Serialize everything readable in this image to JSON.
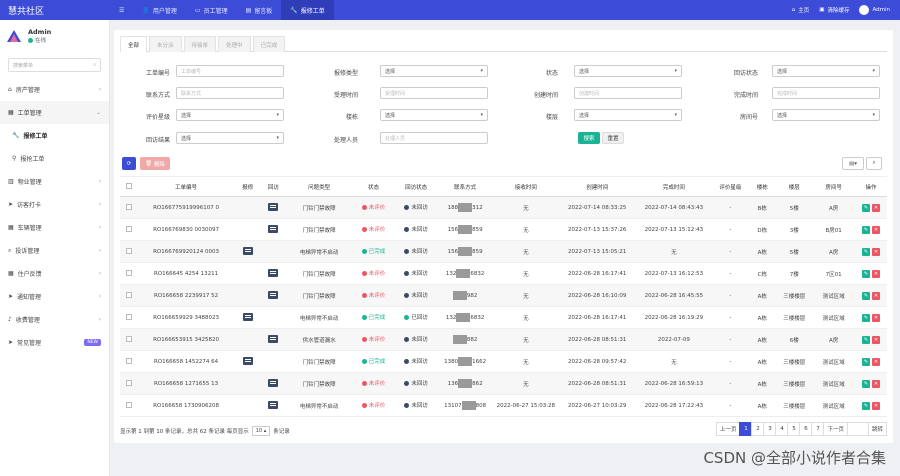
{
  "brand": "慧共社区",
  "topnav": [
    {
      "label": "用户管理",
      "icon": "user-icon"
    },
    {
      "label": "员工管理",
      "icon": "card-icon"
    },
    {
      "label": "留言板",
      "icon": "doc-icon"
    },
    {
      "label": "报修工单",
      "icon": "wrench-icon",
      "active": true
    }
  ],
  "topright": {
    "home": "主页",
    "clear": "清除缓存",
    "user": "Admin"
  },
  "sidebar": {
    "username": "Admin",
    "status": "在线",
    "search_placeholder": "搜索菜单",
    "items": [
      {
        "label": "房产管理",
        "icon": "home-icon"
      },
      {
        "label": "工单管理",
        "icon": "ticket-icon",
        "open": true
      },
      {
        "label": "报修工单",
        "icon": "wrench-icon",
        "sub": true,
        "active": true
      },
      {
        "label": "报抢工单",
        "icon": "pin-icon",
        "sub": true
      },
      {
        "label": "物业管理",
        "icon": "building-icon"
      },
      {
        "label": "访客打卡",
        "icon": "send-icon"
      },
      {
        "label": "车辆管理",
        "icon": "table-icon"
      },
      {
        "label": "投诉管理",
        "icon": "search-icon"
      },
      {
        "label": "住户反馈",
        "icon": "table-icon"
      },
      {
        "label": "通知管理",
        "icon": "send-icon"
      },
      {
        "label": "收费管理",
        "icon": "bell-icon"
      },
      {
        "label": "常见管理",
        "icon": "send-icon",
        "badge": "NEW"
      }
    ]
  },
  "tabs": [
    "全部",
    "未分派",
    "待接单",
    "处理中",
    "已完成"
  ],
  "filters": {
    "labels": [
      "工单编号",
      "报修类型",
      "状态",
      "回访状态",
      "联系方式",
      "受理时间",
      "创建时间",
      "完成时间",
      "评价星级",
      "楼栋",
      "楼层",
      "房间号",
      "回访结果",
      "处理人员"
    ],
    "order_no_placeholder": "工单编号",
    "contact_placeholder": "联系方式",
    "accept_time_placeholder": "受理时间",
    "create_time_placeholder": "创建时间",
    "finish_time_placeholder": "完成时间",
    "handler_placeholder": "处理人员",
    "select_label": "选择",
    "search_btn": "搜索",
    "reset_btn": "重置"
  },
  "toolbar": {
    "delete": "删除"
  },
  "table": {
    "headers": [
      "工单编号",
      "报修",
      "回访",
      "问题类型",
      "状态",
      "回访状态",
      "联系方式",
      "接收时间",
      "创建时间",
      "完成时间",
      "评价星级",
      "楼栋",
      "楼层",
      "房间号",
      "操作"
    ],
    "rows": [
      {
        "no": "RO166775919996107 0",
        "report": false,
        "visit": true,
        "type": "门铃门禁故障",
        "status": "未评价",
        "status_color": "#ed5565",
        "visit_status": "未回访",
        "visit_color": "#3b4a66",
        "phone_a": "188",
        "phone_b": "312",
        "accept": "无",
        "create": "2022-07-14 08:33:25",
        "finish": "2022-07-14 08:43:43",
        "star": "-",
        "bldg": "B栋",
        "floor": "5楼",
        "room": "A房"
      },
      {
        "no": "RO166769830 0030097",
        "report": false,
        "visit": true,
        "type": "门铃门禁故障",
        "status": "未评价",
        "status_color": "#ed5565",
        "visit_status": "未回访",
        "visit_color": "#3b4a66",
        "phone_a": "156",
        "phone_b": "859",
        "accept": "无",
        "create": "2022-07-13 15:37:26",
        "finish": "2022-07-13 15:12:43",
        "star": "-",
        "bldg": "D栋",
        "floor": "3楼",
        "room": "B房01"
      },
      {
        "no": "RO166769920124 0003",
        "report": true,
        "visit": false,
        "type": "电梯异常不启动",
        "status": "已完成",
        "status_color": "#1ab394",
        "visit_status": "未回访",
        "visit_color": "#3b4a66",
        "phone_a": "156",
        "phone_b": "859",
        "accept": "无",
        "create": "2022-07-13 15:05:21",
        "finish": "无",
        "star": "-",
        "bldg": "A栋",
        "floor": "5楼",
        "room": "A房"
      },
      {
        "no": "RO166645 4254 13211",
        "report": false,
        "visit": true,
        "type": "门铃门禁故障",
        "status": "未评价",
        "status_color": "#ed5565",
        "visit_status": "未回访",
        "visit_color": "#3b4a66",
        "phone_a": "132",
        "phone_b": "6832",
        "accept": "无",
        "create": "2022-06-28 16:17:41",
        "finish": "2022-07-13 16:12:53",
        "star": "-",
        "bldg": "C栋",
        "floor": "7楼",
        "room": "7区01"
      },
      {
        "no": "RO166658 2239917 52",
        "report": false,
        "visit": true,
        "type": "门铃门禁故障",
        "status": "未评价",
        "status_color": "#ed5565",
        "visit_status": "未回访",
        "visit_color": "#3b4a66",
        "phone_a": "",
        "phone_b": "982",
        "accept": "无",
        "create": "2022-06-28 16:10:09",
        "finish": "2022-06-28 16:45:55",
        "star": "-",
        "bldg": "A栋",
        "floor": "三楼楼层",
        "room": "测试区域"
      },
      {
        "no": "RO166659929 3488023",
        "report": true,
        "visit": false,
        "type": "电梯异常不启动",
        "status": "已完成",
        "status_color": "#1ab394",
        "visit_status": "已回访",
        "visit_color": "#1ab394",
        "phone_a": "132",
        "phone_b": "6832",
        "accept": "无",
        "create": "2022-06-28 16:17:41",
        "finish": "2022-06-28 16:19:29",
        "star": "-",
        "bldg": "A栋",
        "floor": "三楼楼层",
        "room": "测试区域"
      },
      {
        "no": "RO166653915 3425820",
        "report": false,
        "visit": true,
        "type": "供水管道漏水",
        "status": "未评价",
        "status_color": "#ed5565",
        "visit_status": "未回访",
        "visit_color": "#3b4a66",
        "phone_a": "",
        "phone_b": "882",
        "accept": "无",
        "create": "2022-06-28 08:51:31",
        "finish": "2022-07-09",
        "star": "-",
        "bldg": "A栋",
        "floor": "6楼",
        "room": "A房"
      },
      {
        "no": "RO166658 1452274 64",
        "report": true,
        "visit": false,
        "type": "门铃门禁故障",
        "status": "已完成",
        "status_color": "#1ab394",
        "visit_status": "未回访",
        "visit_color": "#3b4a66",
        "phone_a": "1380",
        "phone_b": "1662",
        "accept": "无",
        "create": "2022-06-28 09:57:42",
        "finish": "无",
        "star": "-",
        "bldg": "A栋",
        "floor": "三楼楼层",
        "room": "测试区域"
      },
      {
        "no": "RO166658 1271655 13",
        "report": false,
        "visit": true,
        "type": "门铃门禁故障",
        "status": "未评价",
        "status_color": "#ed5565",
        "visit_status": "未回访",
        "visit_color": "#3b4a66",
        "phone_a": "136",
        "phone_b": "862",
        "accept": "无",
        "create": "2022-06-28 08:51:31",
        "finish": "2022-06-28 16:59:13",
        "star": "-",
        "bldg": "A栋",
        "floor": "三楼楼层",
        "room": "测试区域"
      },
      {
        "no": "RO166658 1730906208",
        "report": false,
        "visit": true,
        "type": "电梯异常不启动",
        "status": "未评价",
        "status_color": "#ed5565",
        "visit_status": "未回访",
        "visit_color": "#3b4a66",
        "phone_a": "13107",
        "phone_b": "808",
        "accept": "2022-06-27 15:03:28",
        "create": "2022-06-27 10:03:29",
        "finish": "2022-06-28 17:22:43",
        "star": "-",
        "bldg": "A栋",
        "floor": "三楼楼层",
        "room": "测试区域"
      }
    ]
  },
  "pagination": {
    "info_prefix": "显示第 1 到第 10 条记录，总共 62 条记录 每页显示",
    "page_size": "10",
    "info_suffix": "条记录",
    "prev": "上一页",
    "next": "下一页",
    "pages": [
      "1",
      "2",
      "3",
      "4",
      "5",
      "6",
      "7"
    ],
    "go": "跳转"
  },
  "watermark": "CSDN @全部小说作者合集"
}
